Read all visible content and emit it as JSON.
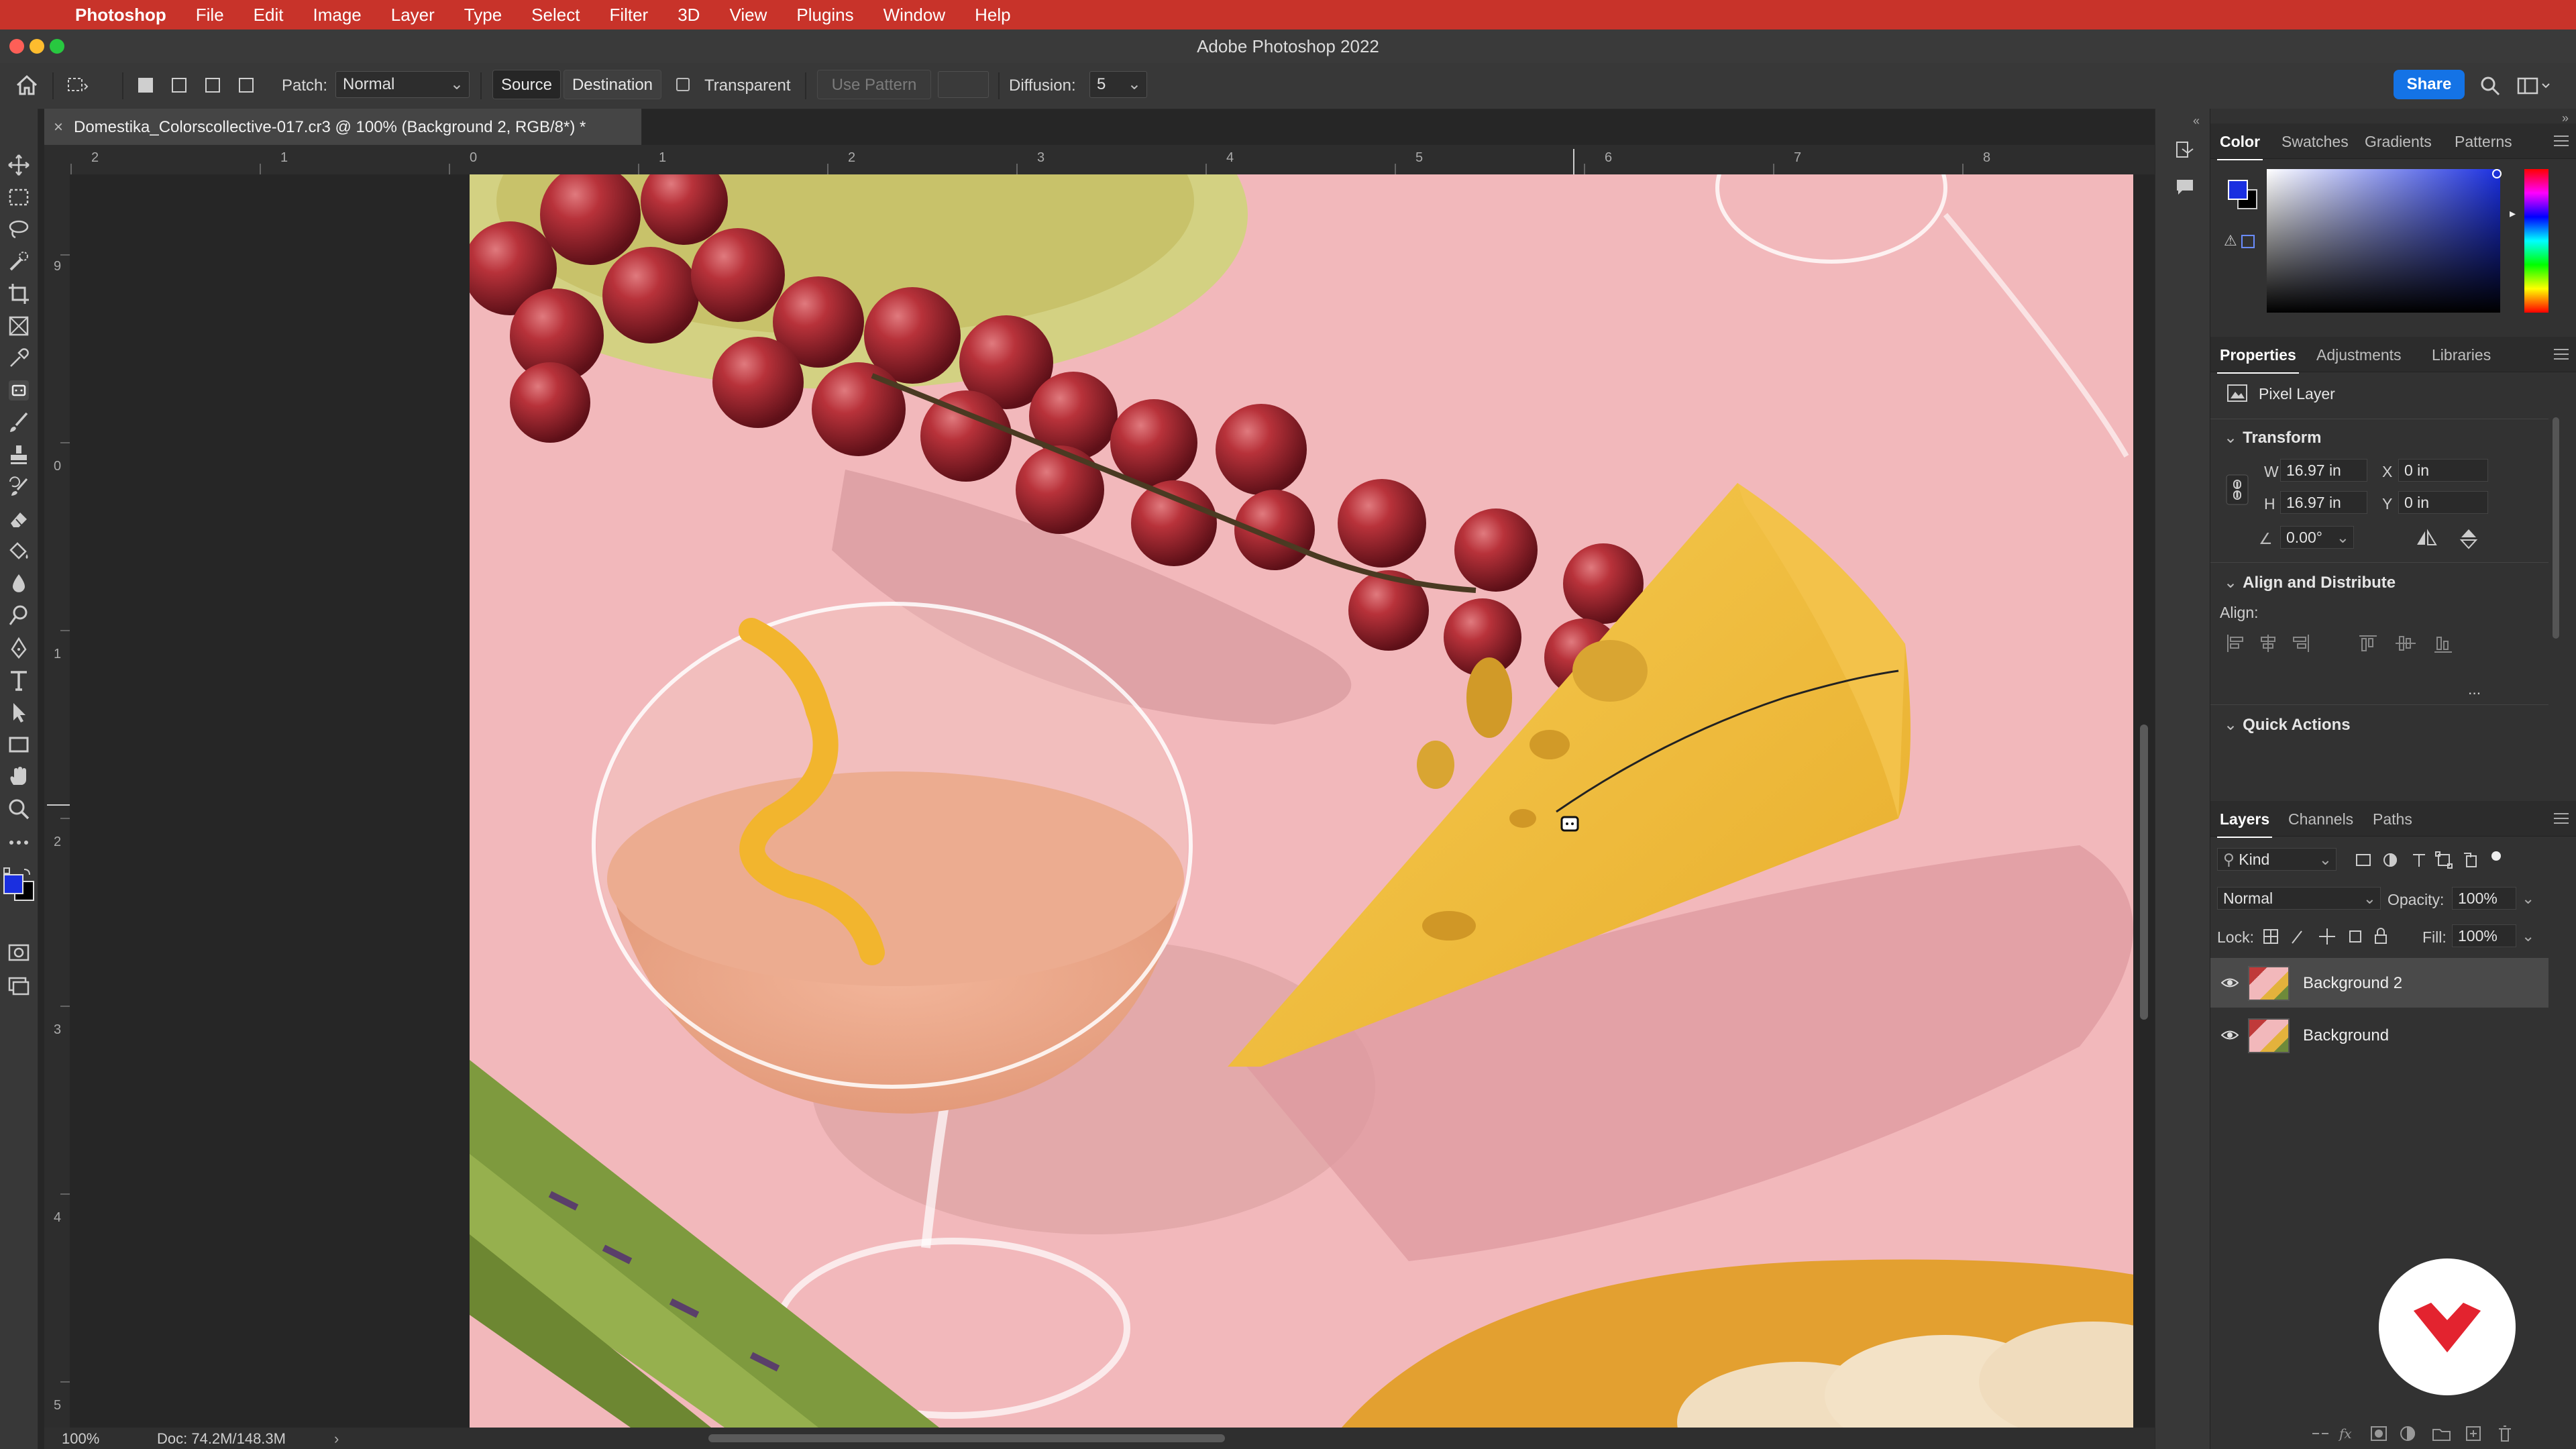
{
  "menubar": {
    "app": "Photoshop",
    "items": [
      "File",
      "Edit",
      "Image",
      "Layer",
      "Type",
      "Select",
      "Filter",
      "3D",
      "View",
      "Plugins",
      "Window",
      "Help"
    ]
  },
  "window": {
    "title": "Adobe Photoshop 2022"
  },
  "options": {
    "patch_label": "Patch:",
    "patch_mode": "Normal",
    "source": "Source",
    "destination": "Destination",
    "transparent": "Transparent",
    "use_pattern": "Use Pattern",
    "diffusion_label": "Diffusion:",
    "diffusion_value": "5",
    "share": "Share"
  },
  "document": {
    "tab_title": "Domestika_Colorscollective-017.cr3 @ 100% (Background 2, RGB/8*) *",
    "zoom": "100%",
    "doc_size": "Doc: 74.2M/148.3M"
  },
  "rulers": {
    "horizontal": [
      "2",
      "1",
      "0",
      "1",
      "2",
      "3",
      "4",
      "5",
      "6",
      "7",
      "8"
    ],
    "vertical": [
      "9",
      "0",
      "1",
      "2",
      "3",
      "4",
      "5"
    ]
  },
  "color_panel": {
    "tabs": [
      "Color",
      "Swatches",
      "Gradients",
      "Patterns"
    ],
    "foreground": "#1a2fe0",
    "background": "#000000"
  },
  "properties_panel": {
    "tabs": [
      "Properties",
      "Adjustments",
      "Libraries"
    ],
    "layer_type": "Pixel Layer",
    "transform_title": "Transform",
    "w_label": "W",
    "w_value": "16.97 in",
    "h_label": "H",
    "h_value": "16.97 in",
    "x_label": "X",
    "x_value": "0 in",
    "y_label": "Y",
    "y_value": "0 in",
    "angle_value": "0.00°",
    "align_title": "Align and Distribute",
    "align_label": "Align:",
    "more": "...",
    "quick_actions_title": "Quick Actions"
  },
  "layers_panel": {
    "tabs": [
      "Layers",
      "Channels",
      "Paths"
    ],
    "filter_kind": "Kind",
    "blend_mode": "Normal",
    "opacity_label": "Opacity:",
    "opacity_value": "100%",
    "lock_label": "Lock:",
    "fill_label": "Fill:",
    "fill_value": "100%",
    "layers": [
      {
        "name": "Background 2",
        "selected": true
      },
      {
        "name": "Background",
        "selected": false
      }
    ]
  },
  "colors": {
    "menubar": "#c8332a",
    "accent": "#1473e6",
    "canvas_pink": "#f2b8bb"
  }
}
